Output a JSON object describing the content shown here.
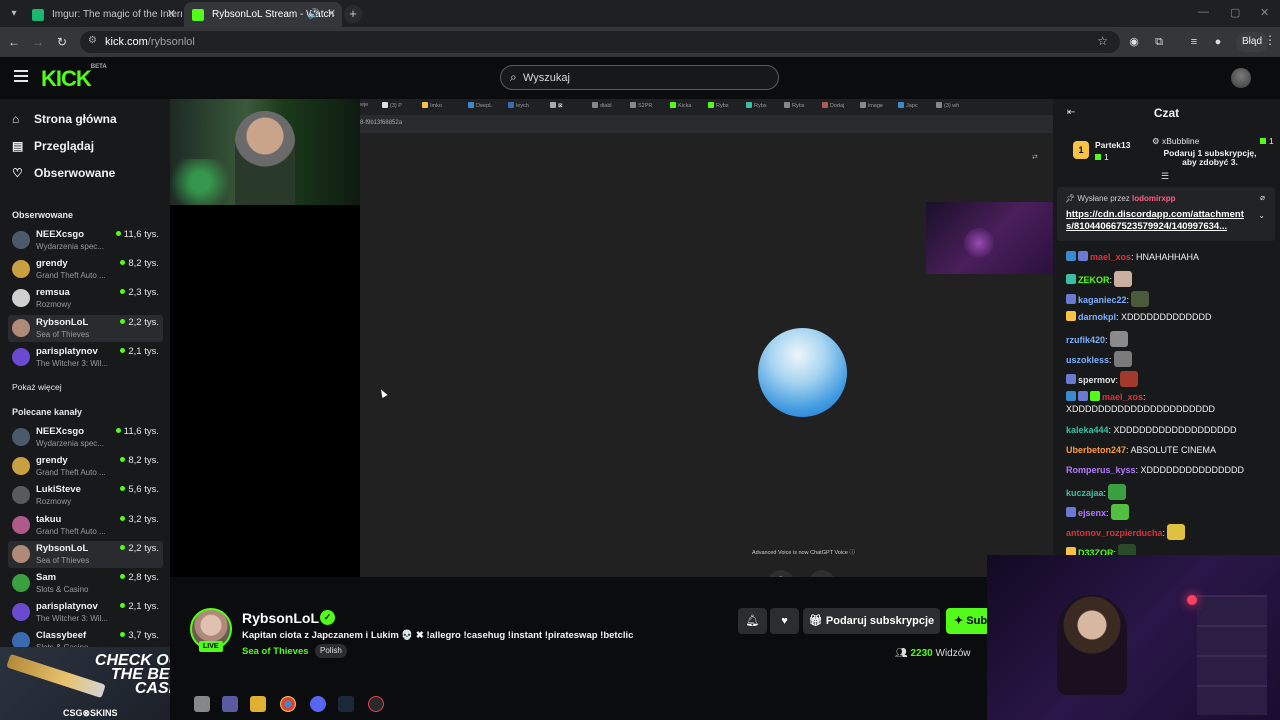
{
  "browser": {
    "tabs": [
      {
        "title": "Imgur: The magic of the Internet",
        "active": false,
        "favicon_color": "#1bb76e"
      },
      {
        "title": "RybsonLoL Stream - Watch",
        "active": true,
        "favicon_color": "#53fc18"
      }
    ],
    "url_host": "kick.com",
    "url_path": "/rybsonlol",
    "error_label": "Błąd"
  },
  "header": {
    "logo": "KICK",
    "logo_sup": "BETA",
    "search_placeholder": "Wyszukaj"
  },
  "sidebar": {
    "nav": [
      {
        "label": "Strona główna",
        "icon": "home-icon"
      },
      {
        "label": "Przeglądaj",
        "icon": "browse-icon"
      },
      {
        "label": "Obserwowane",
        "icon": "heart-icon"
      }
    ],
    "followed_title": "Obserwowane",
    "followed": [
      {
        "name": "NEEXcsgo",
        "category": "Wydarzenia spec...",
        "viewers": "11,6 tys.",
        "color": "#4a5a6a"
      },
      {
        "name": "grendy",
        "category": "Grand Theft Auto ...",
        "viewers": "8,2 tys.",
        "color": "#c9a040"
      },
      {
        "name": "remsua",
        "category": "Rozmowy",
        "viewers": "2,3 tys.",
        "color": "#d0d0d0"
      },
      {
        "name": "RybsonLoL",
        "category": "Sea of Thieves",
        "viewers": "2,2 tys.",
        "color": "#b08a78",
        "selected": true
      },
      {
        "name": "parisplatynov",
        "category": "The Witcher 3: Wil...",
        "viewers": "2,1 tys.",
        "color": "#6a4ad0"
      }
    ],
    "show_more": "Pokaż więcej",
    "recommended_title": "Polecane kanały",
    "recommended": [
      {
        "name": "NEEXcsgo",
        "category": "Wydarzenia spec...",
        "viewers": "11,6 tys.",
        "color": "#4a5a6a"
      },
      {
        "name": "grendy",
        "category": "Grand Theft Auto ...",
        "viewers": "8,2 tys.",
        "color": "#c9a040"
      },
      {
        "name": "LukiSteve",
        "category": "Rozmowy",
        "viewers": "5,6 tys.",
        "color": "#5a5a5a"
      },
      {
        "name": "takuu",
        "category": "Grand Theft Auto ...",
        "viewers": "3,2 tys.",
        "color": "#b05a8a"
      },
      {
        "name": "RybsonLoL",
        "category": "Sea of Thieves",
        "viewers": "2,2 tys.",
        "color": "#b08a78",
        "selected": true
      },
      {
        "name": "Sam",
        "category": "Slots & Casino",
        "viewers": "2,8 tys.",
        "color": "#3aa040"
      },
      {
        "name": "parisplatynov",
        "category": "The Witcher 3: Wil...",
        "viewers": "2,1 tys.",
        "color": "#6a4ad0"
      },
      {
        "name": "Classybeef",
        "category": "Slots & Casino",
        "viewers": "3,7 tys.",
        "color": "#3a6ab0"
      }
    ],
    "promo_text": "CHECK OUT THE BEST CASES",
    "promo_brand": "CSG⊗SKINS"
  },
  "video": {
    "inner_url": "8-f9b13f68852a",
    "voice_note": "Advanced Voice is now ChatGPT Voice ⓘ"
  },
  "stream": {
    "name": "RybsonLoL",
    "live": "LIVE",
    "title": "Kapitan ciota z Japczanem i Lukim 💀 ✖ !allegro !casehug !instant !pirateswap !betclic",
    "category": "Sea of Thieves",
    "language": "Polish",
    "subscribe_gift": "Podaruj subskrypcje",
    "subscribe": "Sub",
    "viewers_count": "2230",
    "viewers_label": "Widzów"
  },
  "chat": {
    "title": "Czat",
    "top_gifter": {
      "name": "Partek13",
      "rank": "1",
      "count": "1"
    },
    "gift_target": {
      "name": "xBubbline",
      "count": "1",
      "message": "Podaruj 1 subskrypcję, aby zdobyć 3."
    },
    "pinned": {
      "sent_by_label": "Wysłane przez",
      "sender": "lodomirxpp",
      "link": "https://cdn.discordapp.com/attachments/810440667523579924/140997634..."
    },
    "messages": [
      {
        "user": "mael_xos",
        "color": "#e0303a",
        "text": ": HNAHAHHAHA",
        "badges": [
          "#3a8ad0",
          "#6a7ad0"
        ]
      },
      {
        "user": "ZEKOR",
        "color": "#53fc18",
        "text": ":",
        "badges": [
          "#3ac0a0"
        ],
        "emote": "#c9b0a0"
      },
      {
        "user": "kaganiec22",
        "color": "#7ab0ff",
        "text": ":",
        "badges": [
          "#6a7ad0"
        ],
        "emote": "#4a5a3a"
      },
      {
        "user": "darnokpl",
        "color": "#7ab0ff",
        "text": ": XDDDDDDDDDDDDD",
        "badges": [
          "#f6c343"
        ]
      },
      {
        "user": "rzufik420",
        "color": "#7ab0ff",
        "text": ":",
        "badges": [],
        "emote": "#8a8a8a"
      },
      {
        "user": "uszokless",
        "color": "#7ab0ff",
        "text": ":",
        "badges": [],
        "emote": "#7a7a7a"
      },
      {
        "user": "spermov",
        "color": "#e0e0e0",
        "text": ":",
        "badges": [
          "#6a7ad0"
        ],
        "emote": "#a03a2a"
      },
      {
        "user": "mael_xos",
        "color": "#e0303a",
        "text": ": XDDDDDDDDDDDDDDDDDDDDDD",
        "badges": [
          "#3a8ad0",
          "#6a7ad0",
          "#53fc18"
        ]
      },
      {
        "user": "kaleka444",
        "color": "#3ac0a0",
        "text": ": XDDDDDDDDDDDDDDDDDD",
        "badges": []
      },
      {
        "user": "Uberbeton247",
        "color": "#ff9a3a",
        "text": ": ABSOLUTE CINEMA",
        "badges": []
      },
      {
        "user": "Romperus_kyss",
        "color": "#b07aff",
        "text": ": XDDDDDDDDDDDDDDD",
        "badges": []
      },
      {
        "user": "kuczajaa",
        "color": "#3ac0a0",
        "text": ":",
        "badges": [],
        "emote": "#3aa040"
      },
      {
        "user": "ejsenx",
        "color": "#b07aff",
        "text": ":",
        "badges": [
          "#6a7ad0"
        ],
        "emote": "#53c040"
      },
      {
        "user": "antonov_rozpierducha",
        "color": "#e0303a",
        "text": ":",
        "badges": [],
        "emote": "#e0c040"
      },
      {
        "user": "D33ZOR",
        "color": "#53fc18",
        "text": ":",
        "badges": [
          "#f6c343"
        ],
        "emote": "#2a4a2a"
      }
    ]
  }
}
